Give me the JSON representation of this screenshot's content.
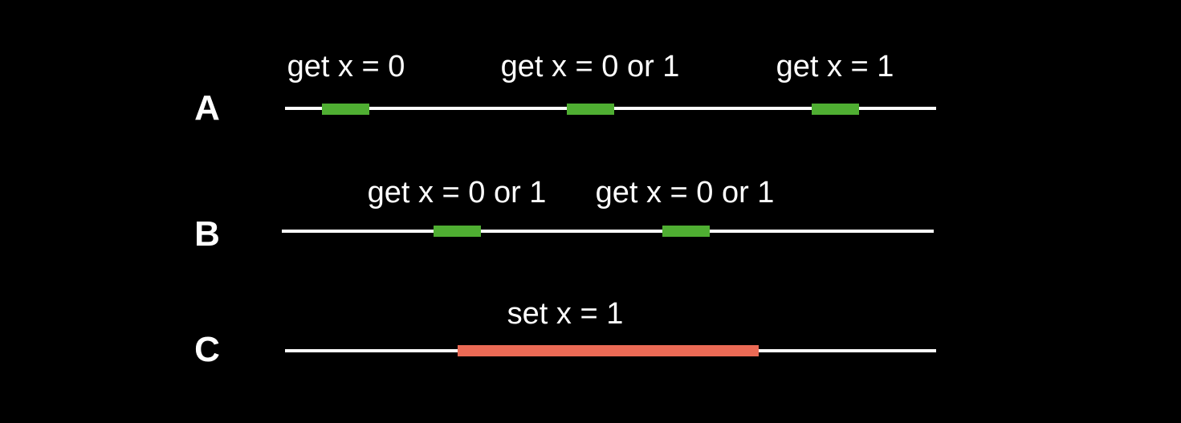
{
  "colors": {
    "background": "#000000",
    "timeline": "#ffffff",
    "get": "#4fae32",
    "set": "#eb6a55",
    "text": "#ffffff"
  },
  "rows": [
    {
      "label": "A",
      "ops": [
        {
          "kind": "get",
          "label": "get x = 0"
        },
        {
          "kind": "get",
          "label": "get x = 0 or 1"
        },
        {
          "kind": "get",
          "label": "get x = 1"
        }
      ]
    },
    {
      "label": "B",
      "ops": [
        {
          "kind": "get",
          "label": "get x = 0 or 1"
        },
        {
          "kind": "get",
          "label": "get x = 0 or 1"
        }
      ]
    },
    {
      "label": "C",
      "ops": [
        {
          "kind": "set",
          "label": "set x = 1"
        }
      ]
    }
  ]
}
